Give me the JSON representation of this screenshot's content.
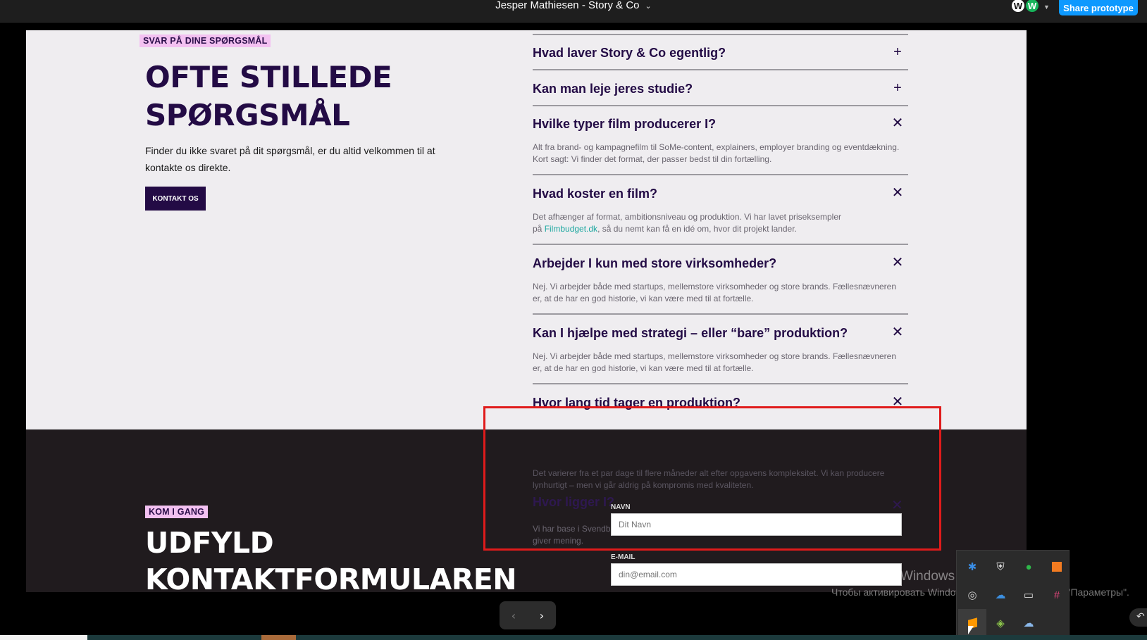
{
  "prototype": {
    "title": "Jesper Mathiesen - Story & Co",
    "share_label": "Share prototype",
    "avatars": [
      "W",
      "W"
    ]
  },
  "faq_section": {
    "tag": "SVAR PÅ DINE SPØRGSMÅL",
    "heading_line1": "OFTE STILLEDE",
    "heading_line2": "SPØRGSMÅL",
    "lead": "Finder du ikke svaret på dit spørgsmål, er du altid velkommen til at kontakte os direkte.",
    "cta": "KONTAKT OS",
    "items": [
      {
        "question": "Hvad laver Story & Co egentlig?",
        "open": false,
        "answer": ""
      },
      {
        "question": "Kan man leje jeres studie?",
        "open": false,
        "answer": ""
      },
      {
        "question": "Hvilke typer film producerer I?",
        "open": true,
        "answer": "Alt fra brand- og kampagnefilm til SoMe-content, explainers, employer branding og eventdækning. Kort sagt: Vi finder det format, der passer bedst til din fortælling."
      },
      {
        "question": "Hvad koster en film?",
        "open": true,
        "answer_pre": "Det afhænger af format, ambitionsniveau og produktion. Vi har lavet priseksempler på ",
        "answer_link": "Filmbudget.dk",
        "answer_post": ", så du nemt kan få en idé om, hvor dit projekt lander."
      },
      {
        "question": "Arbejder I kun med store virksomheder?",
        "open": true,
        "answer": "Nej. Vi arbejder både med startups, mellemstore virksomheder og store brands. Fællesnævneren er, at de har en god historie, vi kan være med til at fortælle."
      },
      {
        "question": "Kan I hjælpe med strategi – eller “bare” produktion?",
        "open": true,
        "answer": "Nej. Vi arbejder både med startups, mellemstore virksomheder og store brands. Fællesnævneren er, at de har en god historie, vi kan være med til at fortælle."
      },
      {
        "question": "Hvor lang tid tager en produktion?",
        "open": true,
        "answer": "Det varierer fra et par dage til flere måneder alt efter opgavens kompleksitet. Vi kan producere lynhurtigt – men vi går aldrig på kompromis med kvaliteten."
      },
      {
        "question": "Hvor ligger I?",
        "open": true,
        "answer": "Vi har base i Svendborg, men arbejder i hele Danmark – og rejser også gerne ud i verden, når det giver mening."
      }
    ]
  },
  "contact_section": {
    "tag": "KOM I GANG",
    "heading_line1": "UDFYLD",
    "heading_line2": "KONTAKTFORMULAREN",
    "name_label": "NAVN",
    "name_placeholder": "Dit Navn",
    "email_label": "E-MAIL",
    "email_placeholder": "din@email.com"
  },
  "windows": {
    "watermark_title": "Активация Windows",
    "watermark_text": "Чтобы активировать Windows, перейдите в раздел \"Параметры\"."
  },
  "icons": [
    "bluetooth-icon",
    "shield-icon",
    "green-app-icon",
    "orange-app-icon",
    "network-icon",
    "cloud-app-icon",
    "usb-icon",
    "slack-icon",
    "sublime-icon",
    "bluestacks-icon",
    "onedrive-icon"
  ],
  "colors": {
    "brand_dark": "#230b45",
    "tag_pink": "#f3c1f1",
    "accent_link": "#1ea8a0",
    "share_blue": "#0d99ff",
    "highlight_red": "#e01b1b"
  }
}
